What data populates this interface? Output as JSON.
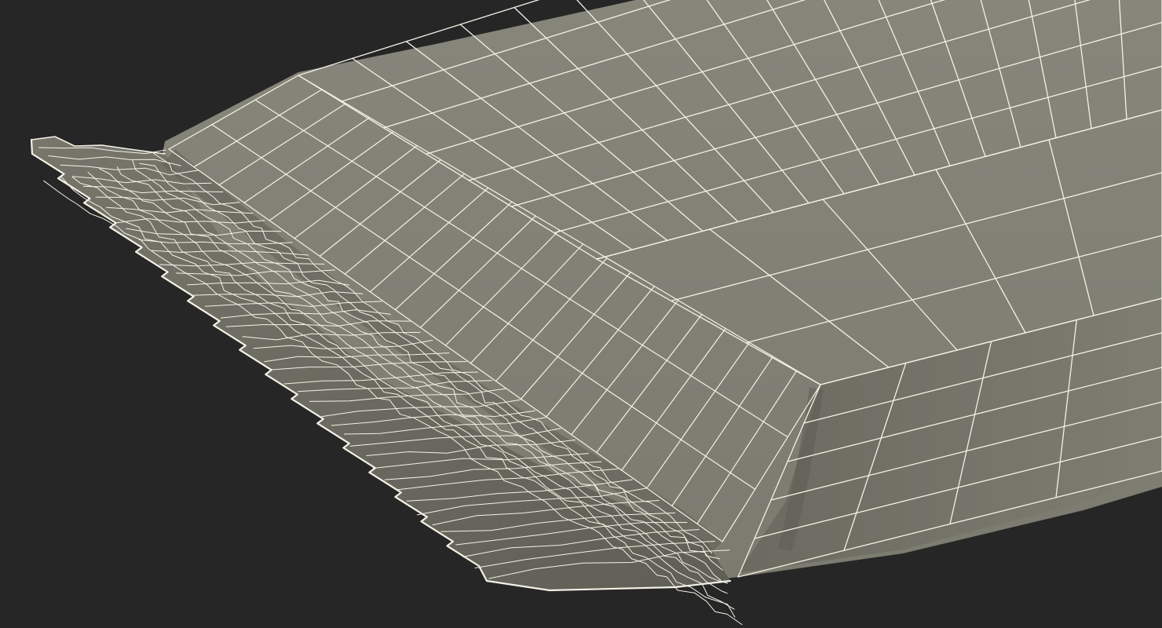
{
  "scene": {
    "subject": "wrapped-bar-wireframe",
    "colors": {
      "background": "#262626",
      "surface": "#7b7b70",
      "surface_dark": "#5f5f56",
      "surface_light": "#86867b",
      "wire": "#f4f2e6"
    }
  }
}
